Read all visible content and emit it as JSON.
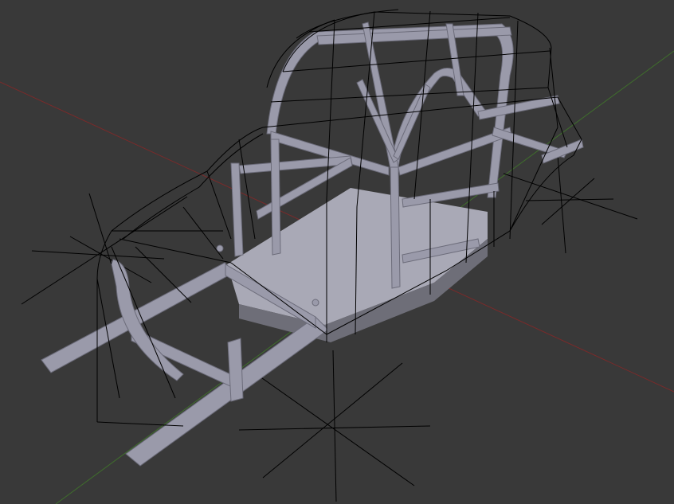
{
  "viewport": {
    "background": "#393939",
    "axis_x_color": "#7a2a2a",
    "axis_y_color": "#3f6e2c",
    "wire_color": "#000000",
    "tube_color": "#9a9aaa",
    "tube_shadow": "#6c6c7a",
    "floor_color": "#a9a9b6",
    "floor_shadow": "#6e6e78"
  },
  "objects": [
    {
      "name": "car-body-wireframe",
      "type": "mesh-wire"
    },
    {
      "name": "roll-cage",
      "type": "mesh-solid"
    },
    {
      "name": "chassis-frame",
      "type": "mesh-solid"
    },
    {
      "name": "floor-pan",
      "type": "mesh-solid"
    },
    {
      "name": "empty-gizmo-front-left",
      "type": "empty"
    },
    {
      "name": "empty-gizmo-front-right",
      "type": "empty"
    },
    {
      "name": "empty-gizmo-rear",
      "type": "empty"
    }
  ]
}
